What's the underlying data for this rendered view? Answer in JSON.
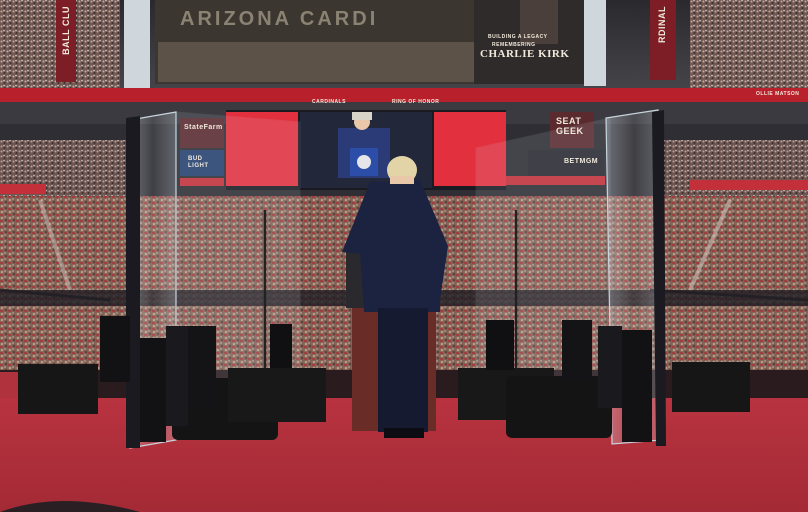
{
  "signage": {
    "stadium_banner": "ARIZONA CARDI",
    "screen_right_line1": "BUILDING A LEGACY",
    "screen_right_line2": "REMEMBERING",
    "screen_right_name": "CHARLIE KIRK",
    "left_column_text": "BALL CLU",
    "right_column_text": "RDINAL",
    "ribbon_cardinals": "CARDINALS",
    "ribbon_ring": "RING OF HONOR",
    "ribbon_ollie": "OLLIE MATSON",
    "sponsor_statefarm": "StateFarm",
    "sponsor_bud": "BUD LIGHT",
    "sponsor_seat": "SEAT GEEK",
    "sponsor_betmgm": "BETMGM"
  },
  "colors": {
    "stage_floor": "#b0323c",
    "crowd": "#7a5b52",
    "ribbon_red": "#b8202c",
    "suit_navy": "#1c2340"
  }
}
